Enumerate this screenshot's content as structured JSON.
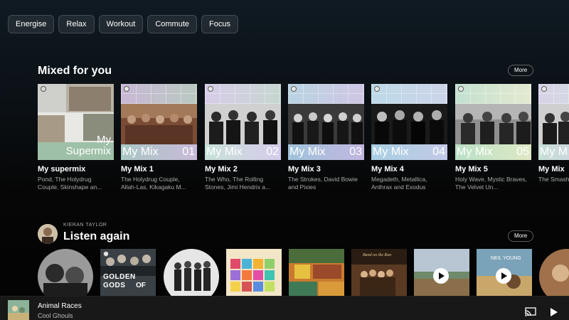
{
  "moods": [
    "Energise",
    "Relax",
    "Workout",
    "Commute",
    "Focus"
  ],
  "mixed": {
    "title": "Mixed for you",
    "more": "More",
    "cards": [
      {
        "art_word": "My\nSupermix",
        "num": "",
        "title": "My supermix",
        "sub": "Pond, The Holydrug Couple, Skinshape an..."
      },
      {
        "art_word": "My Mix",
        "num": "01",
        "title": "My Mix 1",
        "sub": "The Holydrug Couple, Allah-Las, Kikagaku M..."
      },
      {
        "art_word": "My Mix",
        "num": "02",
        "title": "My Mix 2",
        "sub": "The Who, The Rolling Stones, Jimi Hendrix a..."
      },
      {
        "art_word": "My Mix",
        "num": "03",
        "title": "My Mix 3",
        "sub": "The Strokes, David Bowie and Pixies"
      },
      {
        "art_word": "My Mix",
        "num": "04",
        "title": "My Mix 4",
        "sub": "Megadeth, Metallica, Anthrax and Exodus"
      },
      {
        "art_word": "My Mix",
        "num": "05",
        "title": "My Mix 5",
        "sub": "Holy Wave, Mystic Braves, The Velvet Un..."
      },
      {
        "art_word": "My M",
        "num": "",
        "title": "My Mix",
        "sub": "The Smash The Pumpk"
      }
    ]
  },
  "listen": {
    "user": "KIERAN TAYLOR",
    "title": "Listen again",
    "more": "More",
    "album_texts": {
      "golden_gods_1": "GOLDEN",
      "golden_gods_2": "GODS",
      "golden_gods_3": "OF",
      "band_on_run": "Band on the Run",
      "neil_young": "NEIL YOUNG"
    }
  },
  "now_playing": {
    "title": "Animal Races",
    "artist": "Cool Ghouls"
  },
  "colors": {
    "accent_bg": "#0b1116",
    "player_bg": "#181818"
  }
}
